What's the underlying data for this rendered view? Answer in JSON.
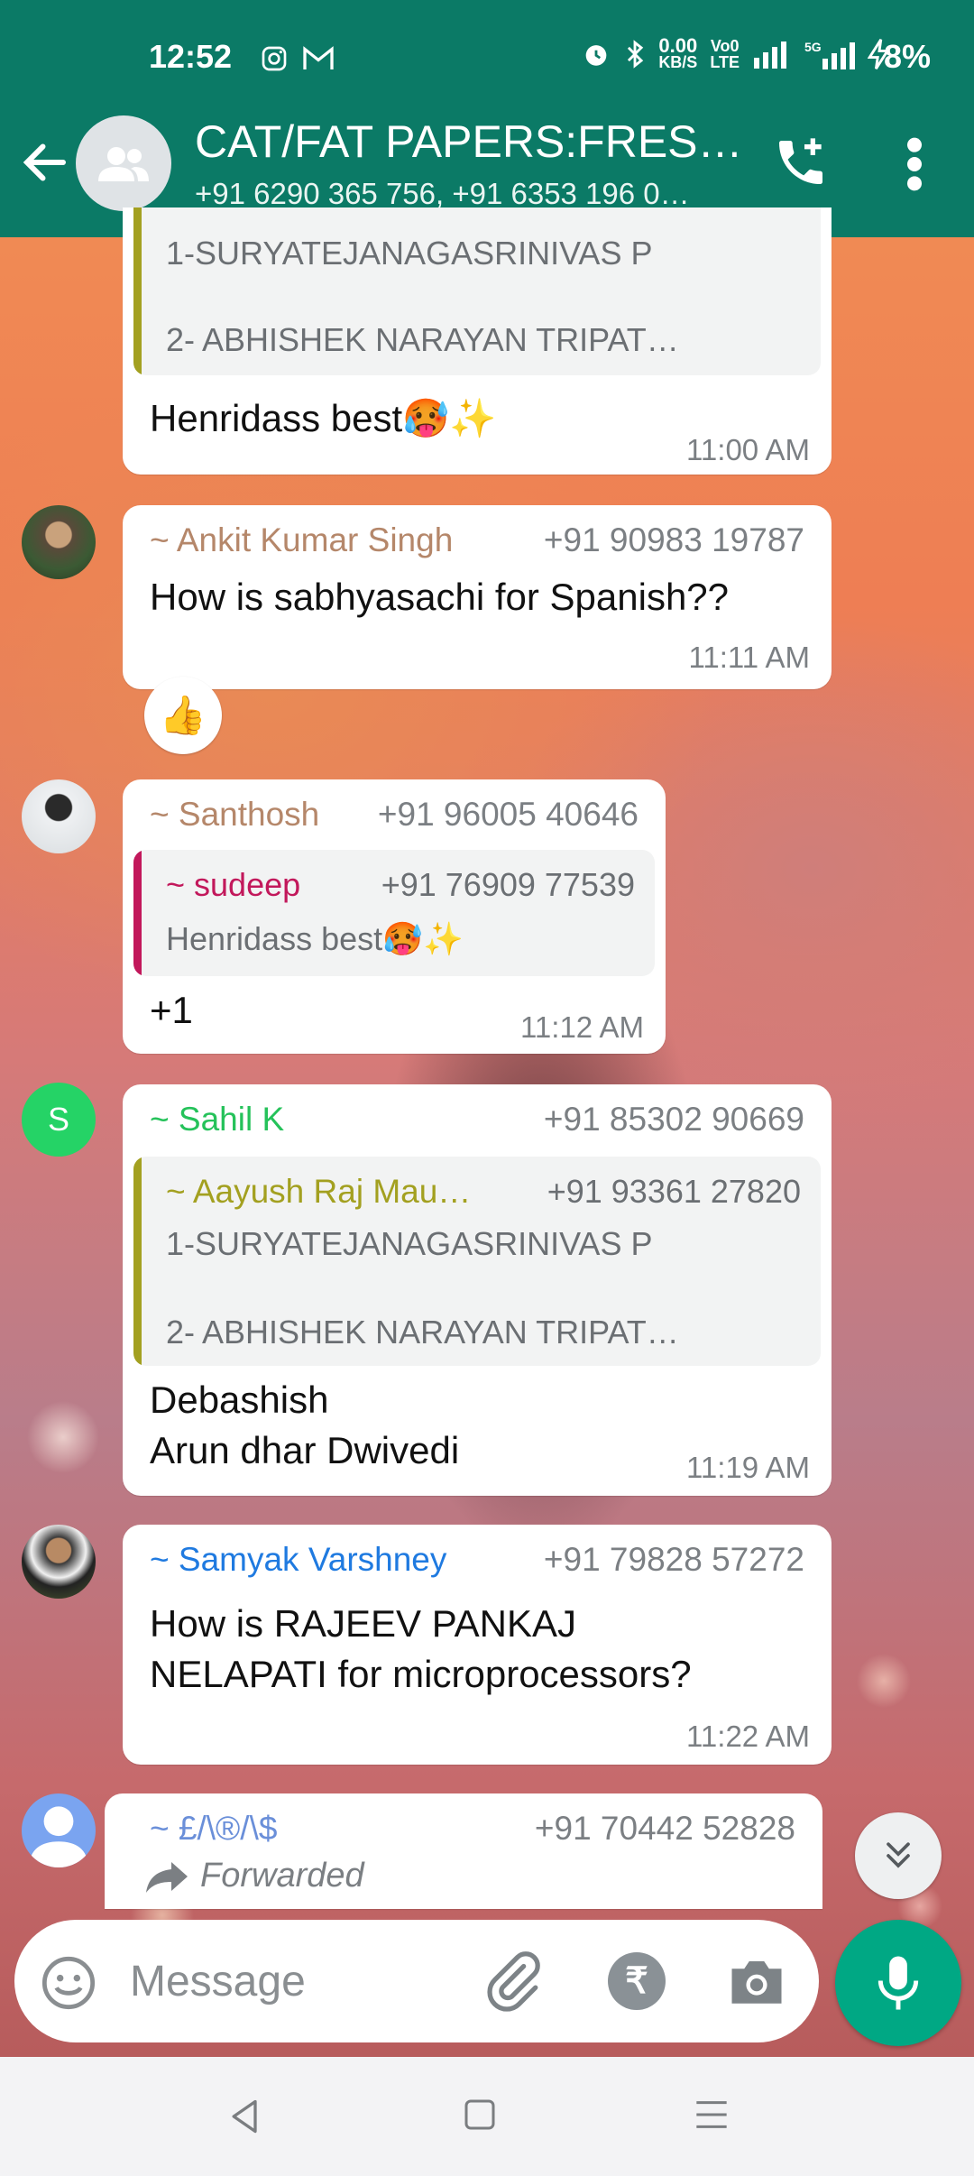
{
  "status_bar": {
    "time": "12:52",
    "net_speed_top": "0.00",
    "net_speed_bottom": "KB/S",
    "battery": "8%"
  },
  "header": {
    "title": "CAT/FAT PAPERS:FRES…",
    "members": "+91 6290 365 756, +91 6353 196 0…"
  },
  "messages": {
    "m1": {
      "quote_line1": "1-SURYATEJANAGASRINIVAS P",
      "quote_line2": "2- ABHISHEK NARAYAN TRIPAT…",
      "text": "Henridass best",
      "emoji": "🥵✨",
      "time": "11:00 AM"
    },
    "m2": {
      "sender": "~ Ankit Kumar Singh",
      "phone": "+91 90983 19787",
      "text": "How is sabhyasachi for Spanish??",
      "time": "11:11 AM",
      "reaction": "👍"
    },
    "m3": {
      "sender": "~ Santhosh",
      "phone": "+91 96005 40646",
      "quote_sender": "~ sudeep",
      "quote_phone": "+91 76909 77539",
      "quote_text": "Henridass best",
      "quote_emoji": "🥵✨",
      "text": "+1",
      "time": "11:12 AM"
    },
    "m4": {
      "avatar_letter": "S",
      "sender": "~ Sahil K",
      "phone": "+91 85302 90669",
      "quote_sender": "~ Aayush Raj Mau…",
      "quote_phone": "+91 93361 27820",
      "quote_line1": "1-SURYATEJANAGASRINIVAS P",
      "quote_line2": "2- ABHISHEK NARAYAN TRIPAT…",
      "text_line1": "Debashish",
      "text_line2": "Arun dhar Dwivedi",
      "time": "11:19 AM"
    },
    "m5": {
      "sender": "~ Samyak Varshney",
      "phone": "+91 79828 57272",
      "text_line1": "How is RAJEEV PANKAJ",
      "text_line2": "NELAPATI for microprocessors?",
      "time": "11:22 AM"
    },
    "m6": {
      "sender": "~ £/\\®/\\$",
      "phone": "+91 70442 52828",
      "forwarded": "Forwarded"
    }
  },
  "composer": {
    "placeholder": "Message"
  },
  "colors": {
    "header_green": "#0b7a66",
    "mic_green": "#00a884",
    "ankit_name": "#b5876a",
    "santhosh_name": "#b5876a",
    "sudeep_name": "#c2185b",
    "sahil_name": "#25c25a",
    "aayush_name": "#a3a020",
    "samyak_name": "#1f7ae0",
    "last_sender_name": "#6a8fd9"
  },
  "icons": [
    "back-arrow-icon",
    "group-icon",
    "add-call-icon",
    "more-vert-icon",
    "emoji-icon",
    "attach-icon",
    "rupee-icon",
    "camera-icon",
    "mic-icon",
    "chevrons-down-icon",
    "forward-icon"
  ]
}
